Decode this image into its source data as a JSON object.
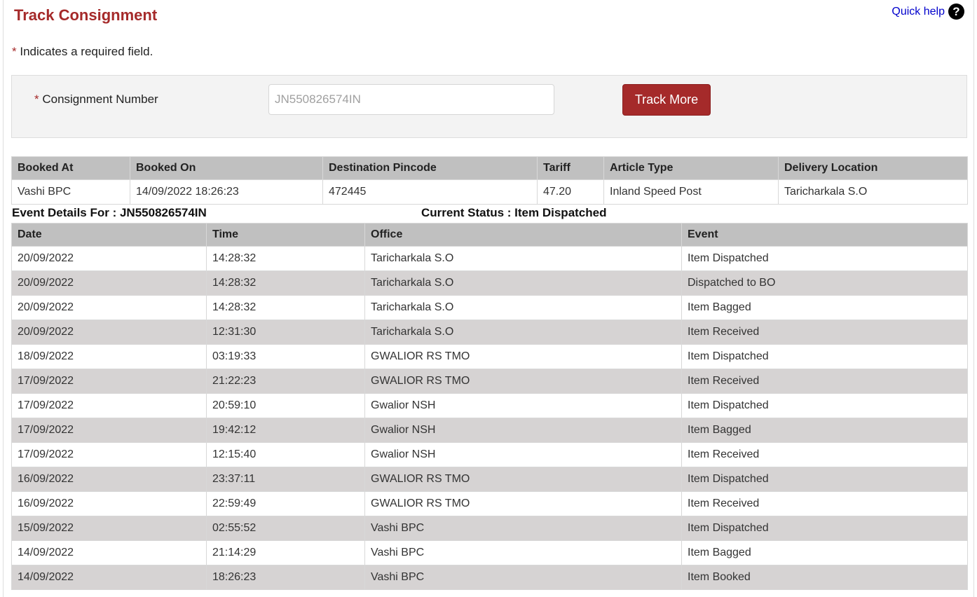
{
  "header": {
    "title": "Track Consignment",
    "quick_help": "Quick help",
    "help_icon_glyph": "?"
  },
  "required_note": {
    "asterisk": "*",
    "text": " Indicates a required field."
  },
  "form": {
    "asterisk": "*",
    "label": " Consignment Number",
    "input_value": "",
    "input_placeholder": "JN550826574IN",
    "button_label": "Track More"
  },
  "booking": {
    "headers": [
      "Booked At",
      "Booked On",
      "Destination Pincode",
      "Tariff",
      "Article Type",
      "Delivery Location"
    ],
    "row": [
      "Vashi BPC",
      "14/09/2022 18:26:23",
      "472445",
      "47.20",
      "Inland Speed Post",
      "Taricharkala S.O"
    ]
  },
  "events": {
    "details_for": "Event Details For : JN550826574IN",
    "current_status": "Current Status : Item Dispatched",
    "headers": [
      "Date",
      "Time",
      "Office",
      "Event"
    ],
    "rows": [
      [
        "20/09/2022",
        "14:28:32",
        "Taricharkala S.O",
        "Item Dispatched"
      ],
      [
        "20/09/2022",
        "14:28:32",
        "Taricharkala S.O",
        "Dispatched to BO"
      ],
      [
        "20/09/2022",
        "14:28:32",
        "Taricharkala S.O",
        "Item Bagged"
      ],
      [
        "20/09/2022",
        "12:31:30",
        "Taricharkala S.O",
        "Item Received"
      ],
      [
        "18/09/2022",
        "03:19:33",
        "GWALIOR RS TMO",
        "Item Dispatched"
      ],
      [
        "17/09/2022",
        "21:22:23",
        "GWALIOR RS TMO",
        "Item Received"
      ],
      [
        "17/09/2022",
        "20:59:10",
        "Gwalior NSH",
        "Item Dispatched"
      ],
      [
        "17/09/2022",
        "19:42:12",
        "Gwalior NSH",
        "Item Bagged"
      ],
      [
        "17/09/2022",
        "12:15:40",
        "Gwalior NSH",
        "Item Received"
      ],
      [
        "16/09/2022",
        "23:37:11",
        "GWALIOR RS TMO",
        "Item Dispatched"
      ],
      [
        "16/09/2022",
        "22:59:49",
        "GWALIOR RS TMO",
        "Item Received"
      ],
      [
        "15/09/2022",
        "02:55:52",
        "Vashi BPC",
        "Item Dispatched"
      ],
      [
        "14/09/2022",
        "21:14:29",
        "Vashi BPC",
        "Item Bagged"
      ],
      [
        "14/09/2022",
        "18:26:23",
        "Vashi BPC",
        "Item Booked"
      ]
    ]
  },
  "colors": {
    "brand": "#a52a2a",
    "link": "#0000cc",
    "header_bg": "#c0c0c0",
    "stripe_bg": "#d6d3d3",
    "panel_bg": "#f3f3f3"
  }
}
